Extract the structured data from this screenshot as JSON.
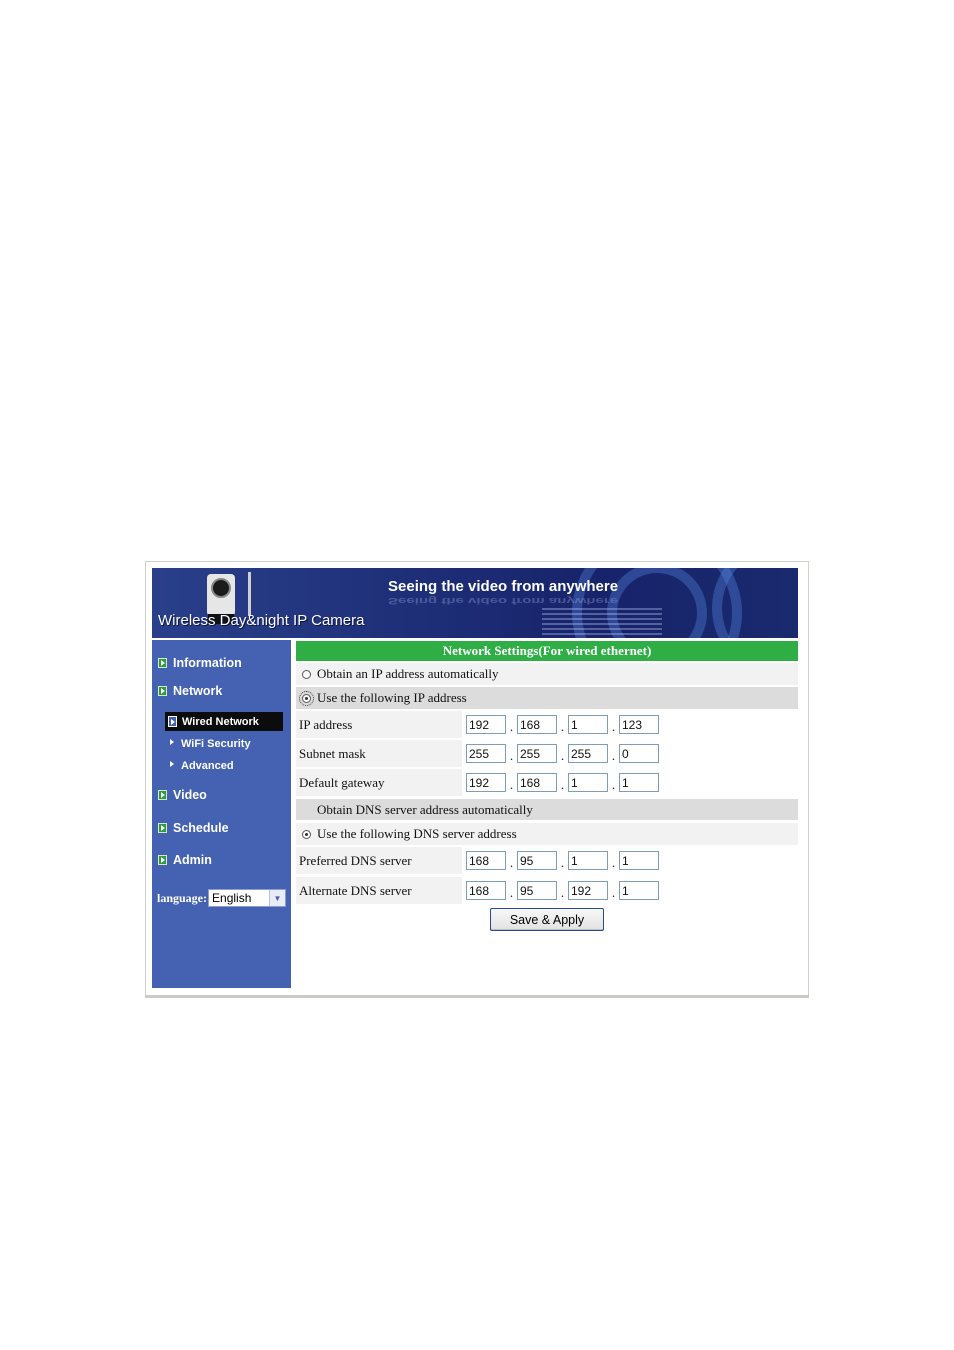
{
  "banner": {
    "tagline": "Seeing the video from anywhere",
    "title": "Wireless Day&night IP Camera"
  },
  "sidebar": {
    "items": [
      {
        "label": "Information"
      },
      {
        "label": "Network"
      },
      {
        "label": "Video"
      },
      {
        "label": "Schedule"
      },
      {
        "label": "Admin"
      }
    ],
    "network_sub": [
      {
        "label": "Wired Network",
        "active": true
      },
      {
        "label": "WiFi Security"
      },
      {
        "label": "Advanced"
      }
    ],
    "language_label": "language:",
    "language_value": "English"
  },
  "main": {
    "section_title": "Network Settings(For wired ethernet)",
    "ip_auto_label": "Obtain an IP address automatically",
    "ip_manual_label": "Use the following IP address",
    "ip_address": {
      "label": "IP address",
      "octets": [
        "192",
        "168",
        "1",
        "123"
      ]
    },
    "subnet_mask": {
      "label": "Subnet mask",
      "octets": [
        "255",
        "255",
        "255",
        "0"
      ]
    },
    "default_gateway": {
      "label": "Default gateway",
      "octets": [
        "192",
        "168",
        "1",
        "1"
      ]
    },
    "dns_auto_label": "Obtain DNS server address automatically",
    "dns_manual_label": "Use the following DNS server address",
    "preferred_dns": {
      "label": "Preferred DNS server",
      "octets": [
        "168",
        "95",
        "1",
        "1"
      ]
    },
    "alternate_dns": {
      "label": "Alternate DNS server",
      "octets": [
        "168",
        "95",
        "192",
        "1"
      ]
    },
    "save_label": "Save & Apply"
  },
  "colors": {
    "sidebar_bg": "#4461b2",
    "header_green": "#2fae46",
    "banner_blue": "#1e2f78"
  }
}
